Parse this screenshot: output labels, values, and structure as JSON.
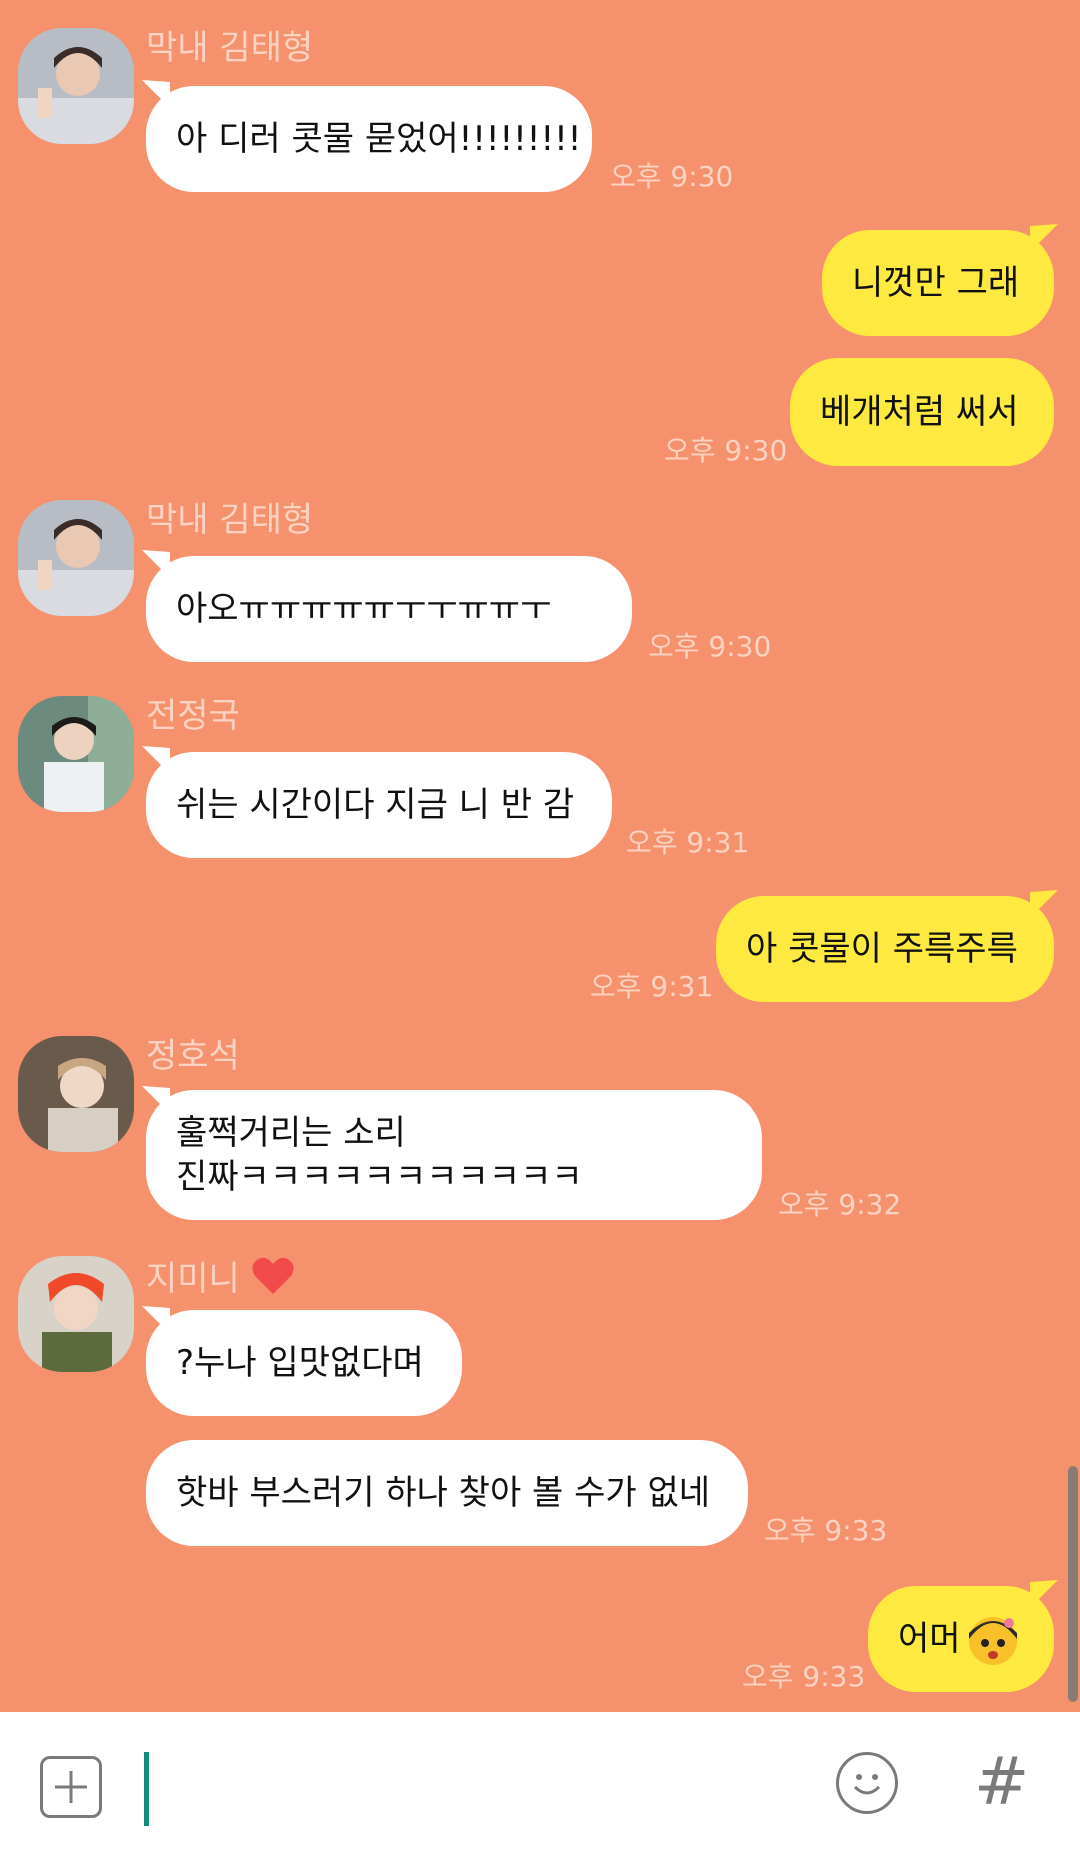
{
  "messages": [
    {
      "sender": "막내 김태형",
      "text": "아 디러 콧물 묻었어!!!!!!!!!",
      "time": "오후 9:30"
    },
    {
      "out1": "니껏만 그래",
      "out2": "베개처럼 써서",
      "time": "오후 9:30"
    },
    {
      "sender": "막내 김태형",
      "text": "아오ㅠㅠㅠㅠㅠㅜㅜㅠㅠㅜ",
      "time": "오후 9:30"
    },
    {
      "sender": "전정국",
      "text": "쉬는 시간이다 지금 니 반 감",
      "time": "오후 9:31"
    },
    {
      "out": "아 콧물이 주륵주륵",
      "time": "오후 9:31"
    },
    {
      "sender": "정호석",
      "line1": "훌쩍거리는 소리",
      "line2": "진짜ㅋㅋㅋㅋㅋㅋㅋㅋㅋㅋㅋ",
      "time": "오후 9:32"
    },
    {
      "sender": "지미니",
      "text1": "?누나 입맛없다며",
      "text2": "핫바 부스러기 하나 찾아 볼 수가 없네",
      "time": "오후 9:33"
    },
    {
      "out": "어머",
      "time": "오후 9:33"
    }
  ],
  "input": {
    "placeholder": ""
  },
  "icons": {
    "plus": "plus-icon",
    "emoji": "emoji-icon",
    "hash": "#"
  },
  "colors": {
    "background": "#f5916d",
    "incoming": "#ffffff",
    "outgoing": "#fde93f",
    "meta": "#fbd3c4"
  }
}
